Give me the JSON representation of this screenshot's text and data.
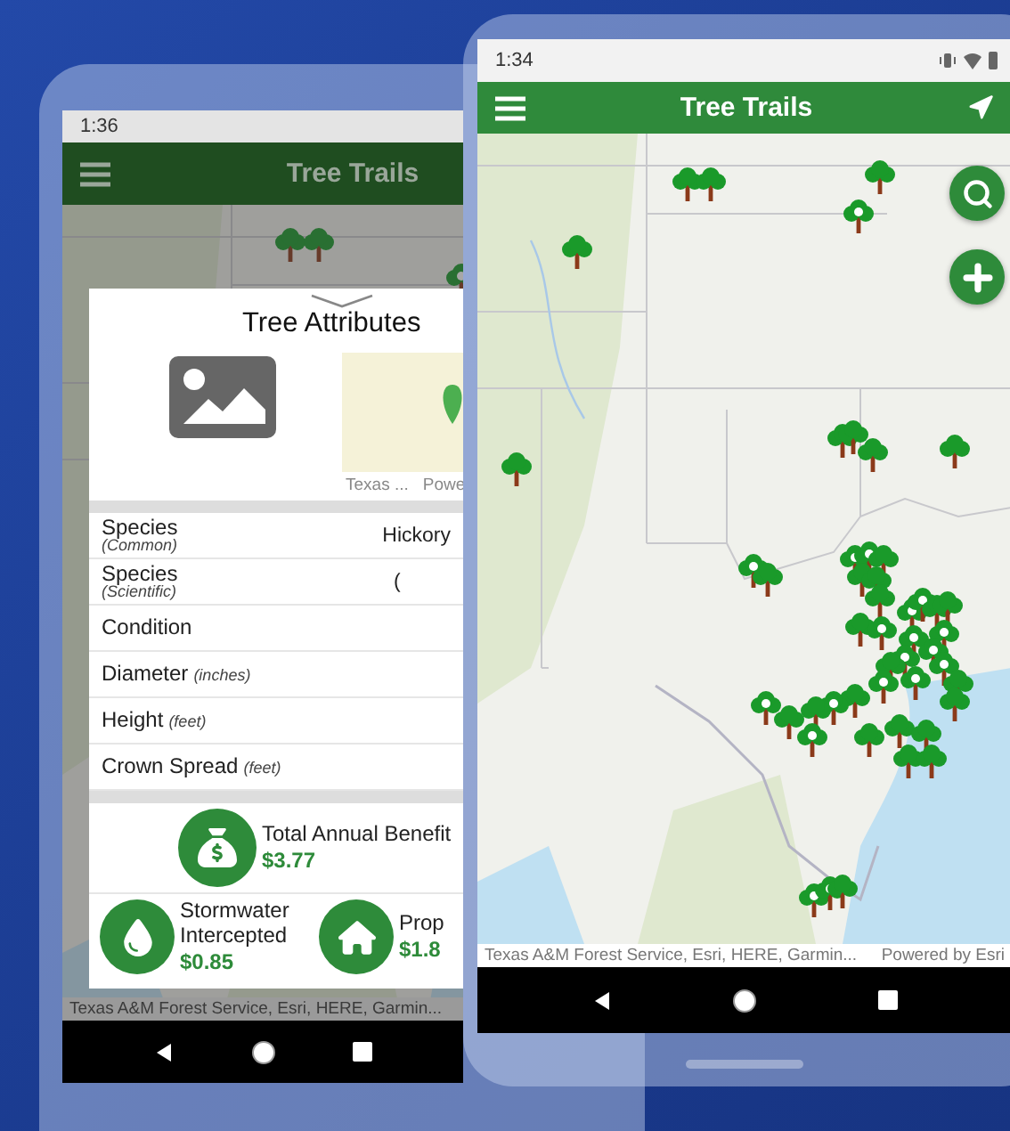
{
  "back_phone": {
    "status_bar": {
      "time": "1:36"
    },
    "app_bar": {
      "title": "Tree Trails"
    },
    "dialog": {
      "title": "Tree Attributes",
      "mini_map_attribution": [
        "Texas ...",
        "Powe"
      ],
      "attributes": [
        {
          "kind": "stacked",
          "label": "Species",
          "note": "(Common)",
          "value": "Hickory"
        },
        {
          "kind": "stacked",
          "label": "Species",
          "note": "(Scientific)",
          "value": "("
        },
        {
          "kind": "plain",
          "label": "Condition"
        },
        {
          "kind": "inline",
          "label": "Diameter",
          "note": "(inches)"
        },
        {
          "kind": "inline",
          "label": "Height",
          "note": "(feet)"
        },
        {
          "kind": "inline",
          "label": "Crown Spread",
          "note": "(feet)"
        }
      ],
      "benefits": [
        {
          "kind": "money",
          "label": "Total Annual Benefit",
          "value": "$3.77"
        },
        {
          "kind": "water",
          "label": "Stormwater Intercepted",
          "value": "$0.85"
        },
        {
          "kind": "house",
          "label": "Prop",
          "value": "$1.8"
        }
      ]
    },
    "attribution": "Texas A&M Forest Service, Esri, HERE, Garmin..."
  },
  "front_phone": {
    "status_bar": {
      "time": "1:34"
    },
    "app_bar": {
      "title": "Tree Trails"
    },
    "attribution": "Texas A&M Forest Service, Esri, HERE, Garmin...",
    "powered_by": "Powered by Esri"
  }
}
